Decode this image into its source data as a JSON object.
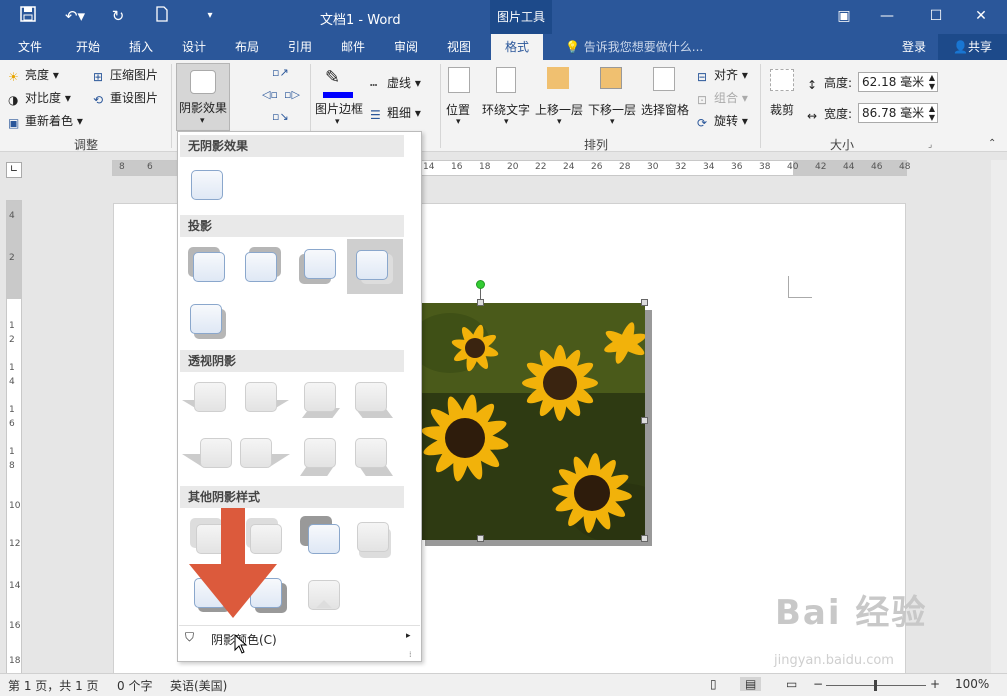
{
  "titlebar": {
    "title": "文档1 - Word",
    "context_tab": "图片工具"
  },
  "menu": {
    "tabs": [
      "文件",
      "开始",
      "插入",
      "设计",
      "布局",
      "引用",
      "邮件",
      "审阅",
      "视图",
      "格式"
    ],
    "active_tab": "格式",
    "tell_me": "告诉我您想要做什么...",
    "login": "登录",
    "share": "共享"
  },
  "ribbon": {
    "adjust": {
      "brightness": "亮度",
      "contrast": "对比度",
      "recolor": "重新着色",
      "compress": "压缩图片",
      "reset": "重设图片",
      "label": "调整"
    },
    "shadow_effects": "阴影效果",
    "border": {
      "picture_border": "图片边框",
      "dashes": "虚线",
      "weight": "粗细"
    },
    "arrange": {
      "position": "位置",
      "wrap_text": "环绕文字",
      "bring_forward": "上移一层",
      "send_backward": "下移一层",
      "selection_pane": "选择窗格",
      "align": "对齐",
      "group": "组合",
      "rotate": "旋转",
      "label": "排列"
    },
    "size": {
      "crop": "裁剪",
      "height_label": "高度:",
      "height_value": "62.18 毫米",
      "width_label": "宽度:",
      "width_value": "86.78 毫米",
      "label": "大小"
    }
  },
  "ruler": {
    "h_numbers": [
      "8",
      "6",
      "14",
      "16",
      "18",
      "20",
      "22",
      "24",
      "26",
      "28",
      "30",
      "32",
      "34",
      "36",
      "38",
      "40",
      "42",
      "44",
      "46",
      "48"
    ],
    "v_numbers": [
      "4",
      "2",
      "1",
      "2",
      "1",
      "4",
      "1",
      "6",
      "1",
      "8",
      "10",
      "12",
      "14",
      "16",
      "18"
    ]
  },
  "dropdown": {
    "sections": [
      "无阴影效果",
      "投影",
      "透视阴影",
      "其他阴影样式"
    ],
    "shadow_color": "阴影颜色(C)"
  },
  "statusbar": {
    "page": "第 1 页，共 1 页",
    "words": "0 个字",
    "language": "英语(美国)",
    "zoom": "100%"
  },
  "watermark": {
    "logo": "Bai 经验",
    "url": "jingyan.baidu.com"
  },
  "colors": {
    "accent": "#2b579a",
    "arrow": "#dc5a3c"
  }
}
